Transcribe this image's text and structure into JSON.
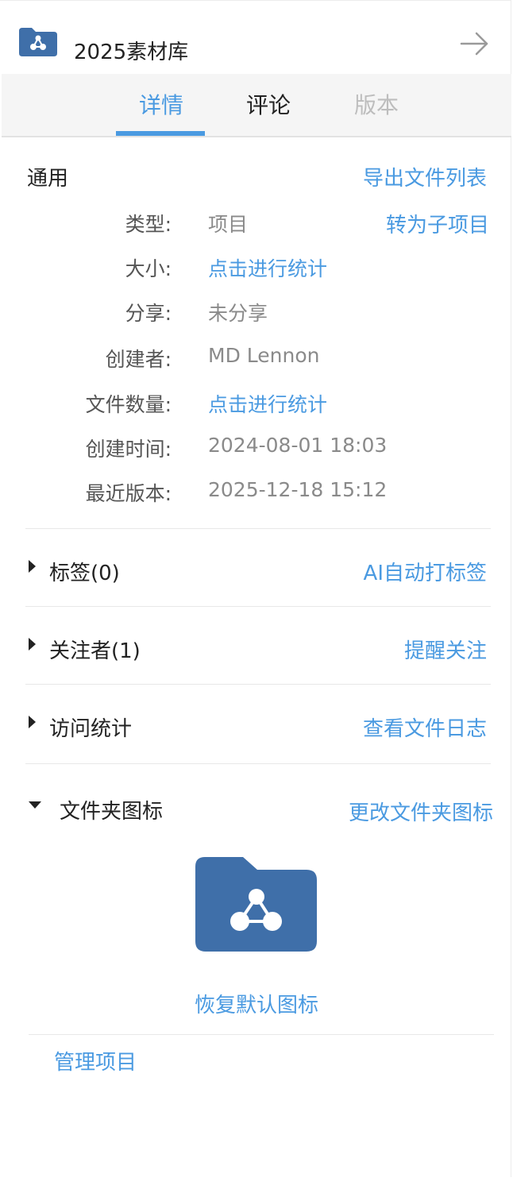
{
  "header": {
    "title": "2025素材库",
    "folder_color": "#3f6fa9"
  },
  "tabs": [
    {
      "label": "详情",
      "state": "active"
    },
    {
      "label": "评论",
      "state": "normal"
    },
    {
      "label": "版本",
      "state": "disabled"
    }
  ],
  "general": {
    "title": "通用",
    "export_link": "导出文件列表",
    "convert_link": "转为子项目",
    "rows": [
      {
        "label": "类型:",
        "value": "项目"
      },
      {
        "label": "大小:",
        "value": "点击进行统计"
      },
      {
        "label": "分享:",
        "value": "未分享"
      },
      {
        "label": "创建者:",
        "value": "MD Lennon"
      },
      {
        "label": "文件数量:",
        "value": "点击进行统计"
      },
      {
        "label": "创建时间:",
        "value": "2024-08-01 18:03"
      },
      {
        "label": "最近版本:",
        "value": "2025-12-18 15:12"
      }
    ]
  },
  "sections": {
    "tags": {
      "title": "标签(0)",
      "action": "AI自动打标签"
    },
    "followers": {
      "title": "关注者(1)",
      "action": "提醒关注"
    },
    "stats": {
      "title": "访问统计",
      "action": "查看文件日志"
    },
    "folder_icon": {
      "title": "文件夹图标",
      "action": "更改文件夹图标",
      "restore": "恢复默认图标"
    }
  },
  "footer": {
    "manage": "管理项目"
  },
  "colors": {
    "accent": "#4a9ae1",
    "folder": "#3f6fa9"
  }
}
